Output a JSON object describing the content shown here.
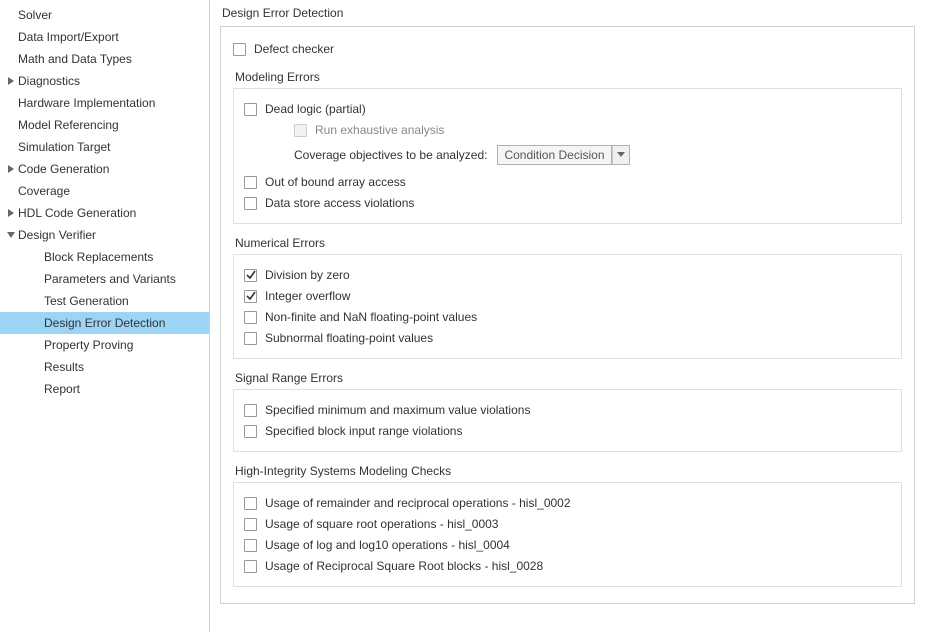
{
  "sidebar": {
    "items": [
      {
        "label": "Solver",
        "level": 0,
        "toggle": null
      },
      {
        "label": "Data Import/Export",
        "level": 0,
        "toggle": null
      },
      {
        "label": "Math and Data Types",
        "level": 0,
        "toggle": null
      },
      {
        "label": "Diagnostics",
        "level": 0,
        "toggle": "collapsed"
      },
      {
        "label": "Hardware Implementation",
        "level": 0,
        "toggle": null
      },
      {
        "label": "Model Referencing",
        "level": 0,
        "toggle": null
      },
      {
        "label": "Simulation Target",
        "level": 0,
        "toggle": null
      },
      {
        "label": "Code Generation",
        "level": 0,
        "toggle": "collapsed"
      },
      {
        "label": "Coverage",
        "level": 0,
        "toggle": null
      },
      {
        "label": "HDL Code Generation",
        "level": 0,
        "toggle": "collapsed"
      },
      {
        "label": "Design Verifier",
        "level": 0,
        "toggle": "expanded"
      },
      {
        "label": "Block Replacements",
        "level": 1,
        "toggle": null
      },
      {
        "label": "Parameters and Variants",
        "level": 1,
        "toggle": null
      },
      {
        "label": "Test Generation",
        "level": 1,
        "toggle": null
      },
      {
        "label": "Design Error Detection",
        "level": 1,
        "toggle": null,
        "selected": true
      },
      {
        "label": "Property Proving",
        "level": 1,
        "toggle": null
      },
      {
        "label": "Results",
        "level": 1,
        "toggle": null
      },
      {
        "label": "Report",
        "level": 1,
        "toggle": null
      }
    ]
  },
  "content": {
    "title": "Design Error Detection",
    "defect_checker": {
      "label": "Defect checker",
      "checked": false
    },
    "modeling_errors": {
      "header": "Modeling Errors",
      "dead_logic": {
        "label": "Dead logic (partial)",
        "checked": false
      },
      "run_exhaustive": {
        "label": "Run exhaustive analysis",
        "checked": false,
        "disabled": true
      },
      "coverage_label": "Coverage objectives to be analyzed:",
      "coverage_value": "Condition Decision",
      "out_of_bound": {
        "label": "Out of bound array access",
        "checked": false
      },
      "data_store": {
        "label": "Data store access violations",
        "checked": false
      }
    },
    "numerical_errors": {
      "header": "Numerical Errors",
      "division_by_zero": {
        "label": "Division by zero",
        "checked": true
      },
      "integer_overflow": {
        "label": "Integer overflow",
        "checked": true
      },
      "non_finite": {
        "label": "Non-finite and NaN floating-point values",
        "checked": false
      },
      "subnormal": {
        "label": "Subnormal floating-point values",
        "checked": false
      }
    },
    "signal_range": {
      "header": "Signal Range Errors",
      "minmax": {
        "label": "Specified minimum and maximum value violations",
        "checked": false
      },
      "input_range": {
        "label": "Specified block input range violations",
        "checked": false
      }
    },
    "hi_checks": {
      "header": "High-Integrity Systems Modeling Checks",
      "hisl_0002": {
        "label": "Usage of remainder and reciprocal operations - hisl_0002",
        "checked": false
      },
      "hisl_0003": {
        "label": "Usage of square root operations - hisl_0003",
        "checked": false
      },
      "hisl_0004": {
        "label": "Usage of log and log10 operations - hisl_0004",
        "checked": false
      },
      "hisl_0028": {
        "label": "Usage of Reciprocal Square Root blocks - hisl_0028",
        "checked": false
      }
    }
  }
}
